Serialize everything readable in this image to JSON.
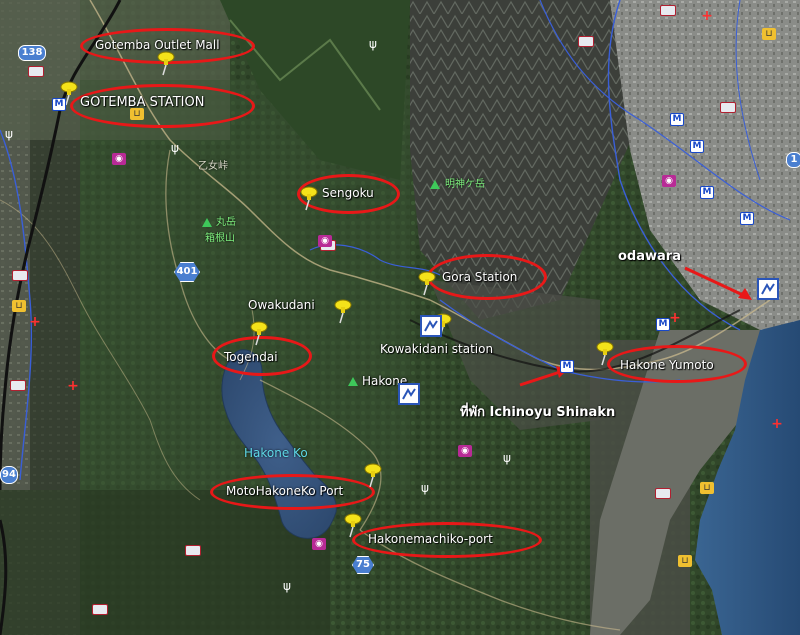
{
  "map": {
    "type": "satellite-terrain",
    "region": "Hakone"
  },
  "highlighted_places": [
    {
      "id": "gotemba-outlet",
      "label": "Gotemba Outlet Mall"
    },
    {
      "id": "gotemba-station",
      "label": "GOTEMBA STATION"
    },
    {
      "id": "sengoku",
      "label": "Sengoku"
    },
    {
      "id": "gora-station",
      "label": "Gora Station"
    },
    {
      "id": "togendai",
      "label": "Togendai"
    },
    {
      "id": "hakone-yumoto",
      "label": "Hakone Yumoto"
    },
    {
      "id": "motohakoneko",
      "label": "MotoHakoneKo Port"
    },
    {
      "id": "hakonemachiko",
      "label": "Hakonemachiko-port"
    }
  ],
  "plain_labels": {
    "owakudani": "Owakudani",
    "kowakidani": "Kowakidani station",
    "hakone": "Hakone",
    "hakone_ko": "Hakone Ko",
    "maru_dake": "丸岳",
    "hakone_yama": "箱根山",
    "myojin": "明神ケ岳",
    "otome": "乙女峠"
  },
  "annotations": {
    "odawara": "odawara",
    "hotel": "ที่พัก Ichinoyu Shinakn"
  },
  "route_shields": {
    "r138": "138",
    "r401": "401",
    "r75": "75",
    "r94": "94",
    "r1": "1"
  },
  "colors": {
    "ellipse": "#e81818",
    "arrow": "#e81818",
    "pin": "#f4e21a",
    "water": "#3c5c86",
    "river": "#3a5fd8",
    "road": "#c9b98e",
    "rail": "#111111"
  },
  "icons": {
    "pin": "pushpin-icon",
    "hotel": "bed-icon",
    "hospital": "cross-icon",
    "station": "metro-icon",
    "shop": "cart-icon",
    "camera": "camera-icon",
    "restaurant": "fork-icon",
    "peak": "mountain-icon",
    "ski": "resort-icon"
  }
}
